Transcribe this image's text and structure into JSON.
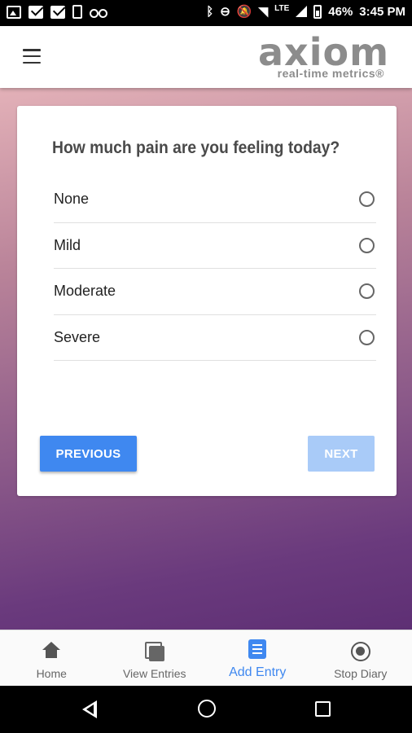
{
  "status_bar": {
    "network": "LTE",
    "battery": "46%",
    "time": "3:45 PM"
  },
  "app_bar": {
    "logo_word": "axiom",
    "logo_tagline": "real-time metrics®"
  },
  "survey": {
    "question": "How much pain are you feeling today?",
    "options": [
      {
        "label": "None"
      },
      {
        "label": "Mild"
      },
      {
        "label": "Moderate"
      },
      {
        "label": "Severe"
      }
    ],
    "previous_label": "PREVIOUS",
    "next_label": "NEXT"
  },
  "bottom_nav": {
    "items": [
      {
        "label": "Home",
        "icon": "home-icon"
      },
      {
        "label": "View Entries",
        "icon": "entries-icon"
      },
      {
        "label": "Add Entry",
        "icon": "add-entry-icon",
        "active": true
      },
      {
        "label": "Stop Diary",
        "icon": "stop-icon"
      }
    ]
  },
  "colors": {
    "accent": "#3f88f0",
    "accent_disabled": "#a9cbf8",
    "gradient_top": "#e3b1b8",
    "gradient_bottom": "#5e2f74"
  }
}
